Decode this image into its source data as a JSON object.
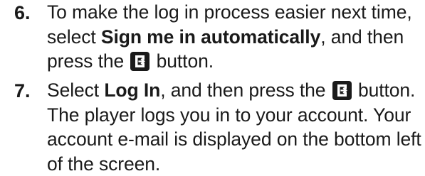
{
  "steps": [
    {
      "number": "6.",
      "lines": [
        {
          "t": "To make the log in process easier next time,"
        },
        {
          "a": "select ",
          "b": "Sign me in automatically",
          "c": ", and then"
        },
        {
          "a": "press the ",
          "c": " button."
        }
      ]
    },
    {
      "number": "7.",
      "lines": [
        {
          "a": "Select ",
          "b": "Log In",
          "c": ", and then press the ",
          "d": " button."
        },
        {
          "t": "The player logs you in to your account. Your"
        },
        {
          "t": "account e-mail is displayed on the bottom left"
        },
        {
          "t": "of the screen."
        }
      ]
    }
  ],
  "icons": {
    "enter": "enter-button-icon"
  }
}
